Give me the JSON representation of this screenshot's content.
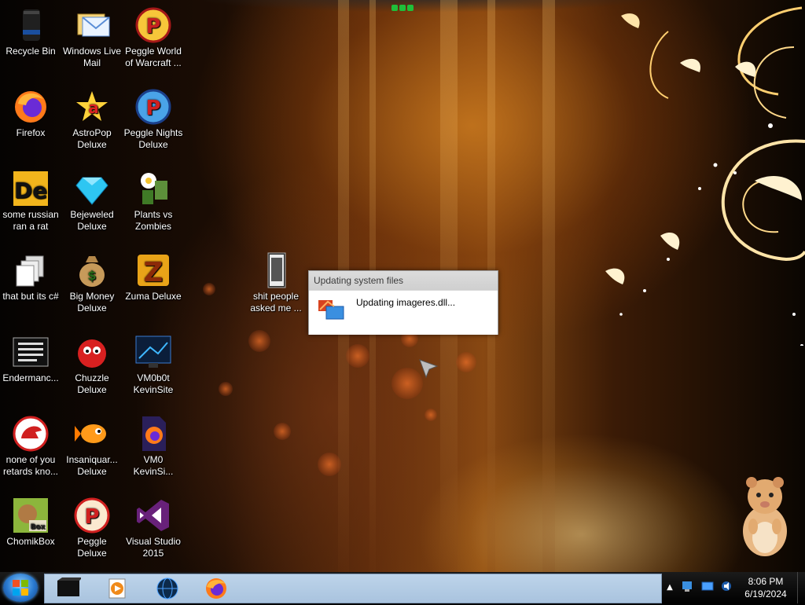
{
  "desktop": {
    "icons": [
      {
        "id": "recycle-bin",
        "label": "Recycle Bin",
        "icon": "recycle-bin-icon"
      },
      {
        "id": "windows-live-mail",
        "label": "Windows Live Mail",
        "icon": "mail-icon"
      },
      {
        "id": "peggle-world-of-warcraft",
        "label": "Peggle World of Warcraft ...",
        "icon": "peggle-icon"
      },
      {
        "id": "firefox",
        "label": "Firefox",
        "icon": "firefox-icon"
      },
      {
        "id": "astropop-deluxe",
        "label": "AstroPop Deluxe",
        "icon": "astropop-icon"
      },
      {
        "id": "peggle-nights-deluxe",
        "label": "Peggle Nights Deluxe",
        "icon": "peggle-nights-icon"
      },
      {
        "id": "some-russian-ran-a-rat",
        "label": "some russian ran a rat",
        "icon": "de-app-icon"
      },
      {
        "id": "bejeweled-deluxe",
        "label": "Bejeweled Deluxe",
        "icon": "diamond-icon"
      },
      {
        "id": "plants-vs-zombies",
        "label": "Plants vs Zombies",
        "icon": "plants-vs-zombies-icon"
      },
      {
        "id": "that-but-its-c",
        "label": "that but its c#",
        "icon": "copy-files-icon"
      },
      {
        "id": "big-money-deluxe",
        "label": "Big Money Deluxe",
        "icon": "money-bag-icon"
      },
      {
        "id": "zuma-deluxe",
        "label": "Zuma Deluxe",
        "icon": "zuma-icon"
      },
      {
        "id": "endermanch",
        "label": "Endermanc...",
        "icon": "document-list-icon"
      },
      {
        "id": "chuzzle-deluxe",
        "label": "Chuzzle Deluxe",
        "icon": "chuzzle-icon"
      },
      {
        "id": "vm0b0t-kevinsite",
        "label": "VM0b0t KevinSite",
        "icon": "monitor-icon"
      },
      {
        "id": "none-of-you-retards",
        "label": "none of you retards kno...",
        "icon": "dino-icon"
      },
      {
        "id": "insaniquarium-deluxe",
        "label": "Insaniquar... Deluxe",
        "icon": "fish-icon"
      },
      {
        "id": "vm0-kevinsite",
        "label": "VM0 KevinSi...",
        "icon": "firefox-file-icon"
      },
      {
        "id": "chomikbox",
        "label": "ChomikBox",
        "icon": "chomikbox-icon"
      },
      {
        "id": "peggle-deluxe",
        "label": "Peggle Deluxe",
        "icon": "peggle-icon"
      },
      {
        "id": "visual-studio-2015",
        "label": "Visual Studio 2015",
        "icon": "visual-studio-icon"
      },
      {
        "id": "shit-people-asked-me",
        "label": "shit people asked me ...",
        "icon": "folder-icon"
      }
    ]
  },
  "dialog": {
    "title": "Updating system files",
    "message": "Updating imageres.dll..."
  },
  "taskbar": {
    "start_label": "Start",
    "pinned": [
      {
        "id": "terminal",
        "icon": "terminal-icon"
      },
      {
        "id": "media-player",
        "icon": "media-player-icon"
      },
      {
        "id": "globe",
        "icon": "globe-icon"
      },
      {
        "id": "firefox",
        "icon": "firefox-icon"
      }
    ],
    "tray_arrow": "▲",
    "clock": {
      "time": "8:06 PM",
      "date": "6/19/2024"
    }
  },
  "colors": {
    "taskbar_strip": "#b3cbe4",
    "dialog_bg": "#f0f0f0",
    "accent_blue": "#2a7bd1"
  }
}
